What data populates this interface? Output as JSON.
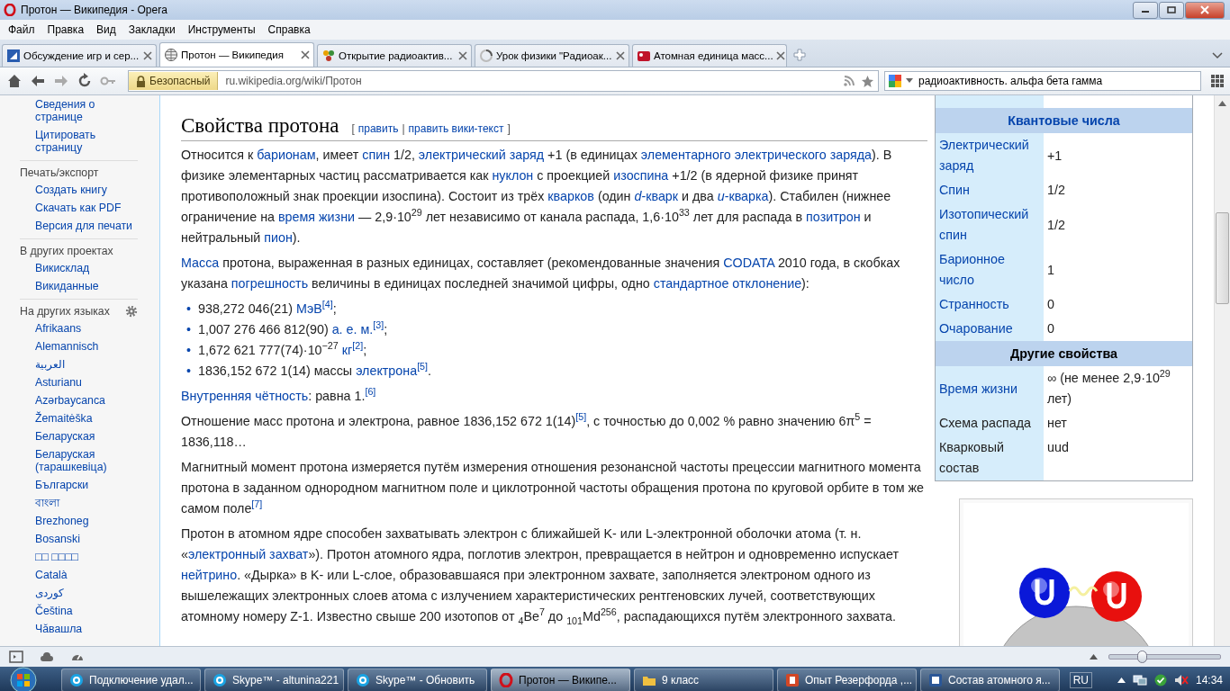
{
  "window": {
    "title": "Протон — Википедия - Opera"
  },
  "menu": [
    "Файл",
    "Правка",
    "Вид",
    "Закладки",
    "Инструменты",
    "Справка"
  ],
  "tabs": [
    {
      "label": "Обсуждение игр и сер...",
      "selected": false,
      "kind": "doc"
    },
    {
      "label": "Протон — Википедия",
      "selected": true,
      "kind": "wiki"
    },
    {
      "label": "Открытие радиоактив...",
      "selected": false,
      "kind": "flower"
    },
    {
      "label": "Урок физики \"Радиоак...",
      "selected": false,
      "kind": "loading"
    },
    {
      "label": "Атомная единица масс...",
      "selected": false,
      "kind": "red"
    }
  ],
  "address": {
    "badge": "Безопасный",
    "url": "ru.wikipedia.org/wiki/Протон"
  },
  "search": {
    "value": "радиоактивность. альфа бета гамма"
  },
  "sidebar": [
    {
      "kind": "plain",
      "items": [
        "Сведения о странице",
        "Цитировать страницу"
      ]
    },
    {
      "kind": "plain",
      "heading": "Печать/экспорт",
      "items": [
        "Создать книгу",
        "Скачать как PDF",
        "Версия для печати"
      ]
    },
    {
      "kind": "plain",
      "heading": "В других проектах",
      "items": [
        "Викисклад",
        "Викиданные"
      ]
    },
    {
      "kind": "languages",
      "heading": "На других языках",
      "items": [
        "Afrikaans",
        "Alemannisch",
        "العربية",
        "Asturianu",
        "Azərbaycanca",
        "Žemaitėška",
        "Беларуская",
        "Беларуская (тарашкевіца)",
        "Български",
        "বাংলা",
        "Brezhoneg",
        "Bosanski",
        "□□ □□□□",
        "Català",
        "کوردی",
        "Čeština",
        "Чӑвашла"
      ]
    }
  ],
  "article": {
    "heading": "Свойства протона",
    "edit": {
      "open": "[",
      "sep": "|",
      "close": "]",
      "links": [
        "править",
        "править вики-текст"
      ]
    },
    "blocks": [
      {
        "kind": "para",
        "parts": [
          {
            "t": "Относится к "
          },
          {
            "t": "барионам",
            "link": true
          },
          {
            "t": ", имеет "
          },
          {
            "t": "спин",
            "link": true
          },
          {
            "t": " 1/2, "
          },
          {
            "t": "электрический заряд",
            "link": true
          },
          {
            "t": " +1 (в единицах "
          },
          {
            "t": "элементарного электрического заряда",
            "link": true
          },
          {
            "t": "). В физике элементарных частиц рассматривается как "
          },
          {
            "t": "нуклон",
            "link": true
          },
          {
            "t": " с проекцией "
          },
          {
            "t": "изоспина",
            "link": true
          },
          {
            "t": " +1/2 (в ядерной физике принят противоположный знак проекции изоспина). Состоит из трёх "
          },
          {
            "t": "кварков",
            "link": true
          },
          {
            "t": " (один "
          },
          {
            "t": "*d*-кварк",
            "link": true
          },
          {
            "t": " и два "
          },
          {
            "t": "*u*-кварка",
            "link": true
          },
          {
            "t": "). Стабилен (нижнее ограничение на "
          },
          {
            "t": "время жизни",
            "link": true
          },
          {
            "t": " — 2,9·10$^{29}$ лет независимо от канала распада, 1,6·10$^{33}$ лет для распада в "
          },
          {
            "t": "позитрон",
            "link": true
          },
          {
            "t": " и нейтральный "
          },
          {
            "t": "пион",
            "link": true
          },
          {
            "t": ")."
          }
        ]
      },
      {
        "kind": "para",
        "parts": [
          {
            "t": "Масса",
            "link": true
          },
          {
            "t": " протона, выраженная в разных единицах, составляет (рекомендованные значения "
          },
          {
            "t": "CODATA",
            "link": true
          },
          {
            "t": " 2010 года, в скобках указана "
          },
          {
            "t": "погрешность",
            "link": true
          },
          {
            "t": " величины в единицах последней значимой цифры, одно "
          },
          {
            "t": "стандартное отклонение",
            "link": true
          },
          {
            "t": "):"
          }
        ]
      },
      {
        "kind": "list",
        "marker": "•",
        "items": [
          [
            {
              "t": "938,272 046(21) "
            },
            {
              "t": "МэВ",
              "link": true
            },
            {
              "t": "$^{[4]}$",
              "link": true
            },
            {
              "t": ";"
            }
          ],
          [
            {
              "t": "1,007 276 466 812(90) "
            },
            {
              "t": "а. е. м.",
              "link": true
            },
            {
              "t": "$^{[3]}$",
              "link": true
            },
            {
              "t": ";"
            }
          ],
          [
            {
              "t": "1,672 621 777(74)·10$^{−27}$ "
            },
            {
              "t": "кг",
              "link": true
            },
            {
              "t": "$^{[2]}$",
              "link": true
            },
            {
              "t": ";"
            }
          ],
          [
            {
              "t": "1836,152 672 1(14) массы "
            },
            {
              "t": "электрона",
              "link": true
            },
            {
              "t": "$^{[5]}$",
              "link": true
            },
            {
              "t": "."
            }
          ]
        ]
      },
      {
        "kind": "para",
        "parts": [
          {
            "t": "Внутренняя чётность",
            "link": true
          },
          {
            "t": ": равна 1."
          },
          {
            "t": "$^{[6]}$",
            "link": true
          }
        ]
      },
      {
        "kind": "para",
        "parts": [
          {
            "t": "Отношение масс протона и электрона, равное 1836,152 672 1(14)"
          },
          {
            "t": "$^{[5]}$",
            "link": true
          },
          {
            "t": ", с точностью до 0,002 % равно значению 6π$^{5}$ = 1836,118…"
          }
        ]
      },
      {
        "kind": "para",
        "parts": [
          {
            "t": "Магнитный момент протона измеряется путём измерения отношения резонансной частоты прецессии магнитного момента протона в заданном однородном магнитном поле и циклотронной частоты обращения протона по круговой орбите в том же самом поле"
          },
          {
            "t": "$^{[7]}$",
            "link": true
          }
        ]
      },
      {
        "kind": "para",
        "parts": [
          {
            "t": "Протон в атомном ядре способен захватывать электрон с ближайшей K- или L-электронной оболочки атома (т. н. «"
          },
          {
            "t": "электронный захват",
            "link": true
          },
          {
            "t": "»). Протон атомного ядра, поглотив электрон, превращается в нейтрон и одновременно испускает "
          },
          {
            "t": "нейтрино",
            "link": true
          },
          {
            "t": ". «Дырка» в K- или L-слое, образовавшаяся при электронном захвате, заполняется электроном одного из вышележащих электронных слоев атома с излучением характеристических рентгеновских лучей, соответствующих атомному номеру Z-1. Известно свыше 200 изотопов от $_{4}$Be$^{7}$ до $_{101}$Md$^{256}$, распадающихся путём электронного захвата."
          }
        ]
      }
    ]
  },
  "infobox": {
    "sections": [
      {
        "title": "Квантовые числа",
        "title_link": true,
        "rows": [
          {
            "label": "Электрический заряд",
            "link": true,
            "value": "+1"
          },
          {
            "label": "Спин",
            "link": true,
            "value": "1/2"
          },
          {
            "label": "Изотопический спин",
            "link": true,
            "value": "1/2"
          },
          {
            "label": "Барионное число",
            "link": true,
            "value": "1"
          },
          {
            "label": "Странность",
            "link": true,
            "value": "0"
          },
          {
            "label": "Очарование",
            "link": true,
            "value": "0"
          }
        ]
      },
      {
        "title": "Другие свойства",
        "title_link": false,
        "rows": [
          {
            "label": "Время жизни",
            "link": true,
            "value": "∞ (не менее 2,9·10$^{29}$ лет)"
          },
          {
            "label": "Схема распада",
            "link": false,
            "value": "нет"
          },
          {
            "label": "Кварковый состав",
            "link": false,
            "value": "uud"
          }
        ]
      }
    ]
  },
  "status_bar": {
    "zoom": {
      "level": 0.3
    }
  },
  "taskbar": {
    "items": [
      {
        "label": "Подключение удал...",
        "kind": "skype",
        "selected": false
      },
      {
        "label": "Skype™ - altunina221",
        "kind": "skype",
        "selected": false
      },
      {
        "label": "Skype™ - Обновить",
        "kind": "skype",
        "selected": false
      },
      {
        "label": "Протон — Википе...",
        "kind": "opera",
        "selected": true
      },
      {
        "label": "9 класс",
        "kind": "folder",
        "selected": false
      },
      {
        "label": "Опыт Резерфорда ,...",
        "kind": "ppt",
        "selected": false
      },
      {
        "label": "Состав атомного я...",
        "kind": "word",
        "selected": false
      }
    ],
    "language": "RU",
    "time": "14:34"
  }
}
